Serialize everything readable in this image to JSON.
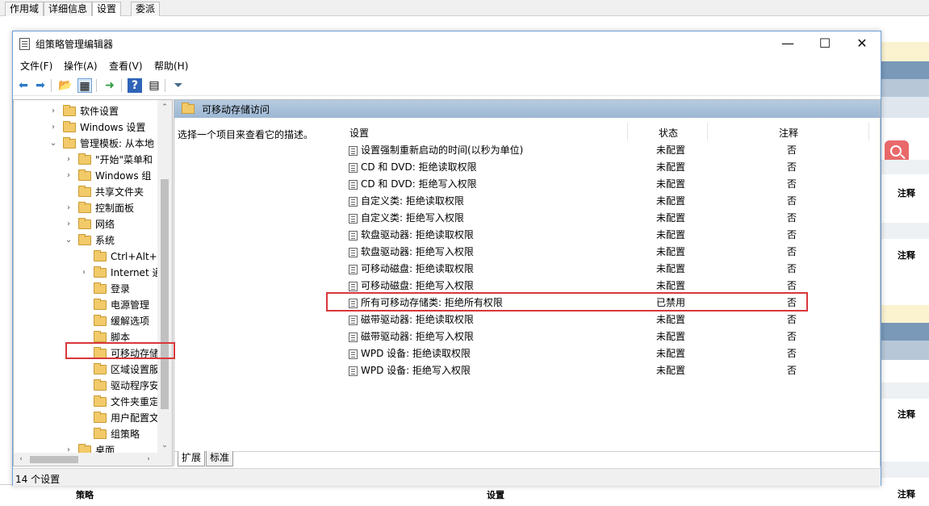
{
  "bg_app": {
    "tabs": [
      "作用域",
      "详细信息",
      "设置",
      "委派"
    ],
    "right_notes": [
      "注释",
      "注释",
      "注释",
      "注释"
    ],
    "bottom": {
      "col_policy": "策略",
      "col_setting": "设置",
      "col_note": "注释"
    },
    "colors": {
      "yellow": "#fbf3d0",
      "steel_blue": "#7a98b8",
      "light_blue": "#b7c7d8",
      "pale": "#dfe6ee"
    }
  },
  "window": {
    "title": "组策略管理编辑器",
    "controls": {
      "minimize": "—",
      "maximize": "☐",
      "close": "✕"
    }
  },
  "menu": [
    "文件(F)",
    "操作(A)",
    "查看(V)",
    "帮助(H)"
  ],
  "toolbar": {
    "icons": [
      "back-arrow-icon",
      "forward-arrow-icon",
      "up-folder-icon",
      "show-hide-tree-icon",
      "export-icon",
      "help-icon",
      "properties-icon",
      "filter-icon"
    ],
    "glyphs": [
      "⬅",
      "➡",
      "📂",
      "▦",
      "➜",
      "?",
      "▤",
      "⏷"
    ]
  },
  "tree": {
    "items": [
      {
        "label": "软件设置",
        "chevron": "›"
      },
      {
        "label": "Windows 设置",
        "chevron": "›"
      },
      {
        "label": "管理模板: 从本地",
        "chevron": "⌄"
      },
      {
        "label": "\"开始\"菜单和",
        "chevron": "›"
      },
      {
        "label": "Windows 组",
        "chevron": "›"
      },
      {
        "label": "共享文件夹",
        "chevron": ""
      },
      {
        "label": "控制面板",
        "chevron": "›"
      },
      {
        "label": "网络",
        "chevron": "›"
      },
      {
        "label": "系统",
        "chevron": "⌄"
      },
      {
        "label": "Ctrl+Alt+",
        "chevron": ""
      },
      {
        "label": "Internet 通",
        "chevron": "›"
      },
      {
        "label": "登录",
        "chevron": ""
      },
      {
        "label": "电源管理",
        "chevron": ""
      },
      {
        "label": "缓解选项",
        "chevron": ""
      },
      {
        "label": "脚本",
        "chevron": ""
      },
      {
        "label": "可移动存储",
        "chevron": ""
      },
      {
        "label": "区域设置服",
        "chevron": ""
      },
      {
        "label": "驱动程序安",
        "chevron": ""
      },
      {
        "label": "文件夹重定",
        "chevron": ""
      },
      {
        "label": "用户配置文",
        "chevron": ""
      },
      {
        "label": "组策略",
        "chevron": ""
      },
      {
        "label": "桌面",
        "chevron": "›"
      }
    ],
    "scroll": {
      "up": "⌃",
      "down": "⌄",
      "left": "‹",
      "right": "›"
    }
  },
  "right": {
    "header": "可移动存储访问",
    "description": "选择一个项目来查看它的描述。",
    "columns": {
      "setting": "设置",
      "state": "状态",
      "note": "注释"
    },
    "rows": [
      {
        "name": "设置强制重新启动的时间(以秒为单位)",
        "state": "未配置",
        "note": "否"
      },
      {
        "name": "CD 和 DVD: 拒绝读取权限",
        "state": "未配置",
        "note": "否"
      },
      {
        "name": "CD 和 DVD: 拒绝写入权限",
        "state": "未配置",
        "note": "否"
      },
      {
        "name": "自定义类: 拒绝读取权限",
        "state": "未配置",
        "note": "否"
      },
      {
        "name": "自定义类: 拒绝写入权限",
        "state": "未配置",
        "note": "否"
      },
      {
        "name": "软盘驱动器: 拒绝读取权限",
        "state": "未配置",
        "note": "否"
      },
      {
        "name": "软盘驱动器: 拒绝写入权限",
        "state": "未配置",
        "note": "否"
      },
      {
        "name": "可移动磁盘: 拒绝读取权限",
        "state": "未配置",
        "note": "否"
      },
      {
        "name": "可移动磁盘: 拒绝写入权限",
        "state": "未配置",
        "note": "否"
      },
      {
        "name": "所有可移动存储类: 拒绝所有权限",
        "state": "已禁用",
        "note": "否"
      },
      {
        "name": "磁带驱动器: 拒绝读取权限",
        "state": "未配置",
        "note": "否"
      },
      {
        "name": "磁带驱动器: 拒绝写入权限",
        "state": "未配置",
        "note": "否"
      },
      {
        "name": "WPD 设备: 拒绝读取权限",
        "state": "未配置",
        "note": "否"
      },
      {
        "name": "WPD 设备: 拒绝写入权限",
        "state": "未配置",
        "note": "否"
      }
    ],
    "tabs": [
      "扩展",
      "标准"
    ]
  },
  "status": "14 个设置",
  "colors": {
    "highlight_red": "#d9373b",
    "header_blue": "#9db7d3",
    "folder_yellow": "#f2ca69"
  }
}
